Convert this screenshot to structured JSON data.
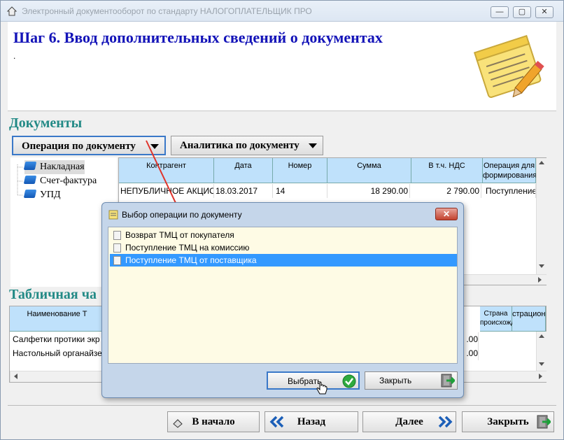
{
  "window": {
    "title": "Электронный документооборот по стандарту НАЛОГОПЛАТЕЛЬЩИК ПРО",
    "minimize": "—",
    "maximize": "▢",
    "close": "✕"
  },
  "header": {
    "title": "Шаг 6. Ввод дополнительных сведений о документах",
    "subtitle": "."
  },
  "documents": {
    "heading": "Документы",
    "dropdowns": [
      "Операция по документу",
      "Аналитика по документу"
    ],
    "tree": [
      "Накладная",
      "Счет-фактура",
      "УПД"
    ],
    "columns": [
      "Контрагент",
      "Дата",
      "Номер",
      "Сумма",
      "В т.ч. НДС",
      "Операция для формирования"
    ],
    "rows": [
      [
        "НЕПУБЛИЧНОЕ АКЦИОН",
        "18.03.2017",
        "14",
        "18 290.00",
        "2 790.00",
        "Поступление Т"
      ]
    ]
  },
  "table_section": {
    "heading": "Табличная ча",
    "columns": [
      "Наименование Т",
      "Страна происхожде",
      "страцион"
    ],
    "rows": [
      {
        "name": "Салфетки протики экр",
        "amount": ".00"
      },
      {
        "name": "Настольный органайзе",
        "amount": ".00"
      }
    ]
  },
  "dialog": {
    "title": "Выбор операции по документу",
    "close": "✕",
    "options": [
      "Возврат ТМЦ от покупателя",
      "Поступление ТМЦ на комиссию",
      "Поступление ТМЦ от поставщика"
    ],
    "selected_index": 2,
    "select_button": "Выбрать",
    "close_button": "Закрыть"
  },
  "nav": {
    "home": "В начало",
    "back": "Назад",
    "next": "Далее",
    "close": "Закрыть"
  },
  "colors": {
    "title_blue": "#1313b8",
    "heading_teal": "#238a86",
    "grid_header": "#bfe1fb",
    "selection": "#3399ff",
    "dialog_list_bg": "#fefbe5"
  }
}
